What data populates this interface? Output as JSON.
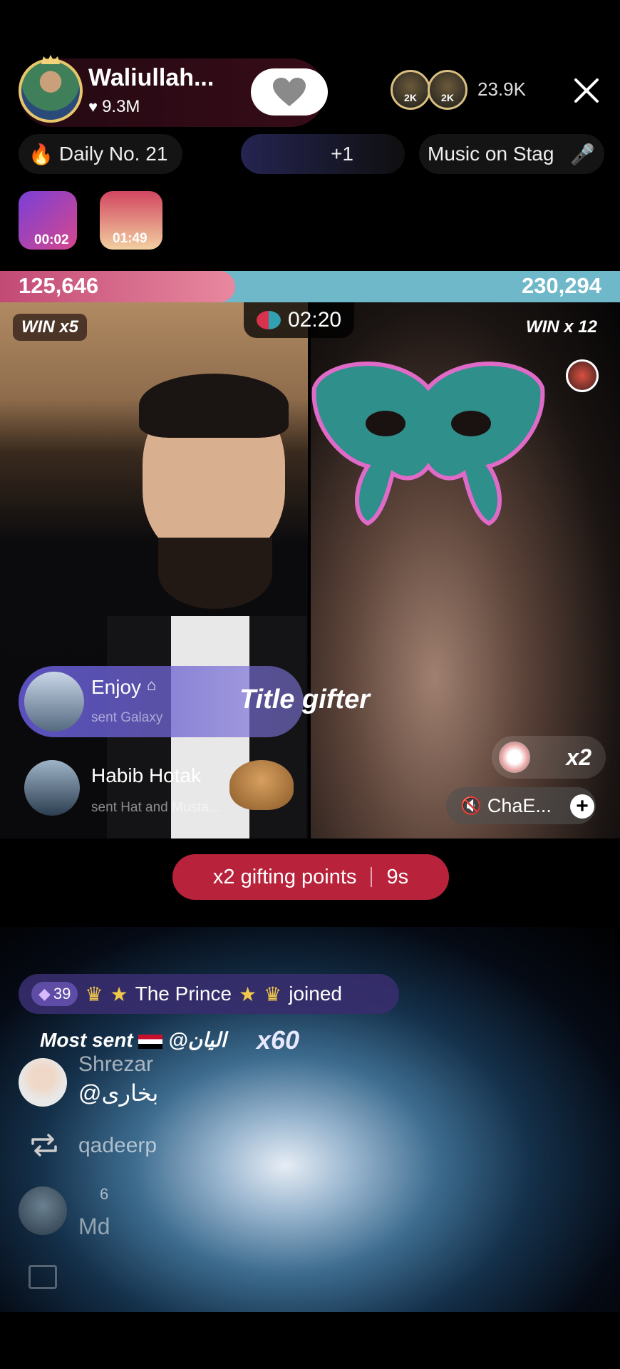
{
  "host": {
    "name": "Waliullah...",
    "likes": "9.3M"
  },
  "viewers": {
    "first_badge": "2K",
    "second_badge": "2K",
    "count": "23.9K"
  },
  "chips": {
    "daily": "Daily No. 21",
    "plus_one": "+1",
    "music": "Music on Stag"
  },
  "timers": {
    "first": "00:02",
    "second": "01:49"
  },
  "battle": {
    "left_score": "125,646",
    "right_score": "230,294",
    "left_win": "WIN x5",
    "right_win": "WIN x 12",
    "time_left": "02:20"
  },
  "gifts": {
    "gift1_user": "Enjoy",
    "gift1_desc": "sent Galaxy",
    "gift2_user": "Habib Hotak",
    "gift2_desc": "sent Hat and Musta...",
    "title_gifter": "Title gifter",
    "multiplier": "x2"
  },
  "guest": {
    "name": "ChaE..."
  },
  "gifting_points": {
    "label": "x2 gifting points",
    "time": "9s"
  },
  "chat": {
    "join_level": "39",
    "join_name": "The Prince",
    "join_action": "joined",
    "most_sent_label": "Most sent",
    "most_sent_user": "@اليان",
    "most_sent_count": "x60",
    "msg1_name": "Shrezar",
    "msg1_text": "@بخاری",
    "msg2_name": "qadeerp",
    "msg3_name": "6",
    "msg3_text": "Md"
  },
  "colors": {
    "left_team": "#c24a75",
    "right_team": "#6fb8c9",
    "gifting_pill": "#b8233b"
  }
}
